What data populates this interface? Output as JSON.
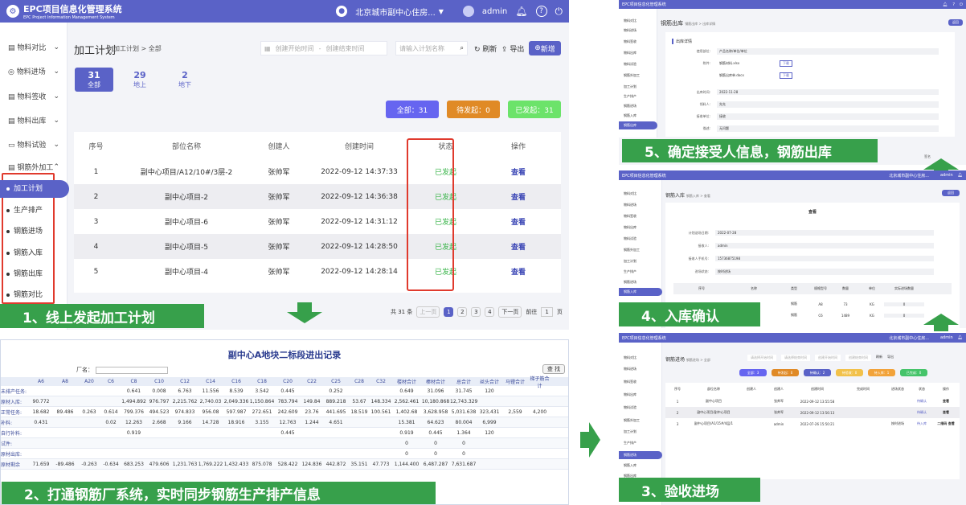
{
  "app": {
    "title": "EPC项目信息化管理系统",
    "subtitle": "EPC Project Information Management System",
    "location": "北京城市副中心住房...",
    "user": "admin"
  },
  "sidebar": {
    "items": [
      {
        "label": "物料对比"
      },
      {
        "label": "物料进场"
      },
      {
        "label": "物料签收"
      },
      {
        "label": "物料出库"
      },
      {
        "label": "物料试验"
      },
      {
        "label": "钢筋外加工"
      }
    ],
    "subitems": [
      {
        "label": "加工计划"
      },
      {
        "label": "生产排产"
      },
      {
        "label": "钢筋进场"
      },
      {
        "label": "钢筋入库"
      },
      {
        "label": "钢筋出库"
      },
      {
        "label": "钢筋对比"
      }
    ]
  },
  "panel1": {
    "page_title": "加工计划",
    "breadcrumb": "加工计划 > 全部",
    "start_ph": "创建开始时间",
    "end_ph": "创建结束时间",
    "range_sep": "-",
    "search_ph": "请输入计划名称",
    "refresh": "刷新",
    "export": "导出",
    "add": "新增",
    "tabs": [
      {
        "count": "31",
        "label": "全部"
      },
      {
        "count": "29",
        "label": "地上"
      },
      {
        "count": "2",
        "label": "地下"
      }
    ],
    "stats": [
      "全部：31",
      "待发起：0",
      "已发起：31"
    ],
    "cols": [
      "序号",
      "部位名称",
      "创建人",
      "创建时间",
      "状态",
      "操作"
    ],
    "rows": [
      [
        "1",
        "副中心项目/A12/10#/3层-2",
        "张帅军",
        "2022-09-12 14:37:33",
        "已发起",
        "查看"
      ],
      [
        "2",
        "副中心项目-2",
        "张帅军",
        "2022-09-12 14:36:38",
        "已发起",
        "查看"
      ],
      [
        "3",
        "副中心项目-6",
        "张帅军",
        "2022-09-12 14:31:12",
        "已发起",
        "查看"
      ],
      [
        "4",
        "副中心项目-5",
        "张帅军",
        "2022-09-12 14:28:50",
        "已发起",
        "查看"
      ],
      [
        "5",
        "副中心项目-4",
        "张帅军",
        "2022-09-12 14:28:14",
        "已发起",
        "查看"
      ]
    ],
    "pager": {
      "total": "共 31 条",
      "prev": "上一页",
      "pages": [
        "1",
        "2",
        "3",
        "4"
      ],
      "next": "下一页",
      "goto": "前往",
      "page": "1",
      "unit": "页"
    },
    "caption": "1、线上发起加工计划"
  },
  "panel2": {
    "title": "副中心A地块二标段进出记录",
    "factory_label": "厂名：",
    "query": "查 找",
    "cols": [
      "",
      "A6",
      "A8",
      "A20",
      "C6",
      "C8",
      "C10",
      "C12",
      "C14",
      "C16",
      "C18",
      "C20",
      "C22",
      "C25",
      "C28",
      "C32",
      "楼材合计",
      "棒材合计",
      "总合计",
      "丝头合计",
      "马镫合计",
      "梯子筋合计"
    ],
    "rows": [
      [
        "未排产任务:",
        "",
        "",
        "",
        "",
        "0.641",
        "0.008",
        "6.763",
        "11.556",
        "8.539",
        "3.542",
        "0.445",
        "",
        "0.252",
        "",
        "",
        "0.649",
        "31.096",
        "31.745",
        "120",
        "",
        ""
      ],
      [
        "原材入库:",
        "90.772",
        "",
        "",
        "",
        "1,494.892",
        "976.797",
        "2,215.762",
        "2,740.03",
        "2,049.336",
        "1,150.864",
        "783.794",
        "149.84",
        "889.218",
        "53.67",
        "148.334",
        "2,562.461",
        "10,180.868",
        "12,743.329",
        "",
        "",
        ""
      ],
      [
        "正常任务:",
        "18.682",
        "89.486",
        "0.263",
        "0.614",
        "799.376",
        "494.523",
        "974.833",
        "956.08",
        "597.987",
        "272.651",
        "242.609",
        "23.76",
        "441.695",
        "18.519",
        "100.561",
        "1,402.68",
        "3,628.958",
        "5,031.638",
        "323,431",
        "2,559",
        "4,200"
      ],
      [
        "补料:",
        "0.431",
        "",
        "",
        "0.02",
        "12.263",
        "2.668",
        "9.166",
        "14.728",
        "18.916",
        "3.155",
        "12.763",
        "1.244",
        "4.651",
        "",
        "",
        "15.381",
        "64.623",
        "80.004",
        "6,999",
        "",
        ""
      ],
      [
        "自行补料:",
        "",
        "",
        "",
        "",
        "0.919",
        "",
        "",
        "",
        "",
        "",
        "0.445",
        "",
        "",
        "",
        "",
        "0.919",
        "0.445",
        "1.364",
        "120",
        "",
        ""
      ],
      [
        "试件:",
        "",
        "",
        "",
        "",
        "",
        "",
        "",
        "",
        "",
        "",
        "",
        "",
        "",
        "",
        "",
        "0",
        "0",
        "0",
        "",
        "",
        ""
      ],
      [
        "原材出库:",
        "",
        "",
        "",
        "",
        "",
        "",
        "",
        "",
        "",
        "",
        "",
        "",
        "",
        "",
        "",
        "0",
        "0",
        "0",
        "",
        "",
        ""
      ],
      [
        "原材剩余",
        "71.659",
        "-89.486",
        "-0.263",
        "-0.634",
        "683.253",
        "479.606",
        "1,231.763",
        "1,769.222",
        "1,432.433",
        "875.078",
        "528.422",
        "124.836",
        "442.872",
        "35.151",
        "47.773",
        "1,144.400",
        "6,487.287",
        "7,631.687",
        "",
        "",
        ""
      ]
    ],
    "caption": "2、打通钢筋厂系统，实时同步钢筋生产排产信息"
  },
  "panel3": {
    "page_title": "钢筋进场",
    "breadcrumb": "钢筋进场 > 全部",
    "start_ph": "请选择开始时间",
    "end_ph": "请选择结束时间",
    "c_start": "创建开始时间",
    "c_end": "创建结束时间",
    "refresh": "刷新",
    "export": "导出",
    "stats": [
      "全部：3",
      "待发起：0",
      "待确认：2",
      "待验收：0",
      "待入库：1",
      "已完成：0"
    ],
    "cols": [
      "序号",
      "部位名称",
      "创建人",
      "创建人",
      "创建时间",
      "完成时间",
      "进场状态",
      "状态",
      "操作"
    ],
    "rows": [
      [
        "1",
        "副中心项目",
        "",
        "张帅军",
        "2022-09-12 13:55:58",
        "",
        "",
        "待确认",
        "查看"
      ],
      [
        "2",
        "副中心项目/副中心项目",
        "",
        "张帅军",
        "2022-09-12 13:56:13",
        "",
        "",
        "待确认",
        "查看"
      ],
      [
        "3",
        "副中心项目/A1/15#/4层/1",
        "",
        "admin",
        "2022-07-26 15:50:21",
        "",
        "按时进场",
        "待入库",
        "二维码 查看"
      ]
    ],
    "caption": "3、验收进场"
  },
  "panel4": {
    "page_title": "钢筋入库",
    "breadcrumb": "钢筋入库 > 查看",
    "back": "返回",
    "heading": "查看",
    "fields": [
      {
        "label": "计划送场日期:",
        "value": "2022-07-28"
      },
      {
        "label": "接收人:",
        "value": "admin"
      },
      {
        "label": "接收人手机号:",
        "value": "15736875198"
      },
      {
        "label": "进场状态:",
        "value": "按时进场"
      }
    ],
    "cols": [
      "序号",
      "名称",
      "类型",
      "规格型号",
      "数量",
      "单位",
      "实际进场数量"
    ],
    "rows": [
      [
        "",
        "",
        "钢筋",
        "A8",
        "73",
        "KG",
        "0"
      ],
      [
        "",
        "",
        "钢筋",
        "C6",
        "1489",
        "KG",
        "0"
      ]
    ],
    "caption": "4、入库确认"
  },
  "panel5": {
    "page_title": "钢筋出库",
    "breadcrumb": "钢筋出库 > 出库详情",
    "back": "返回",
    "section": "出库详情",
    "sign": "签名",
    "fields": [
      {
        "label": "使用部位:",
        "value": "产品名称/单位/单位"
      },
      {
        "label": "附件:",
        "value": "钢筋材料.xlsx",
        "action": "下载"
      },
      {
        "label": "",
        "value": "钢筋出库单.docx",
        "action": "下载"
      },
      {
        "label": "出库时间:",
        "value": "2022-11-28"
      },
      {
        "label": "领料人:",
        "value": "先先"
      },
      {
        "label": "接收单位:",
        "value": "接收"
      },
      {
        "label": "描述:",
        "value": "无问题"
      }
    ],
    "caption": "5、确定接受人信息，钢筋出库"
  }
}
